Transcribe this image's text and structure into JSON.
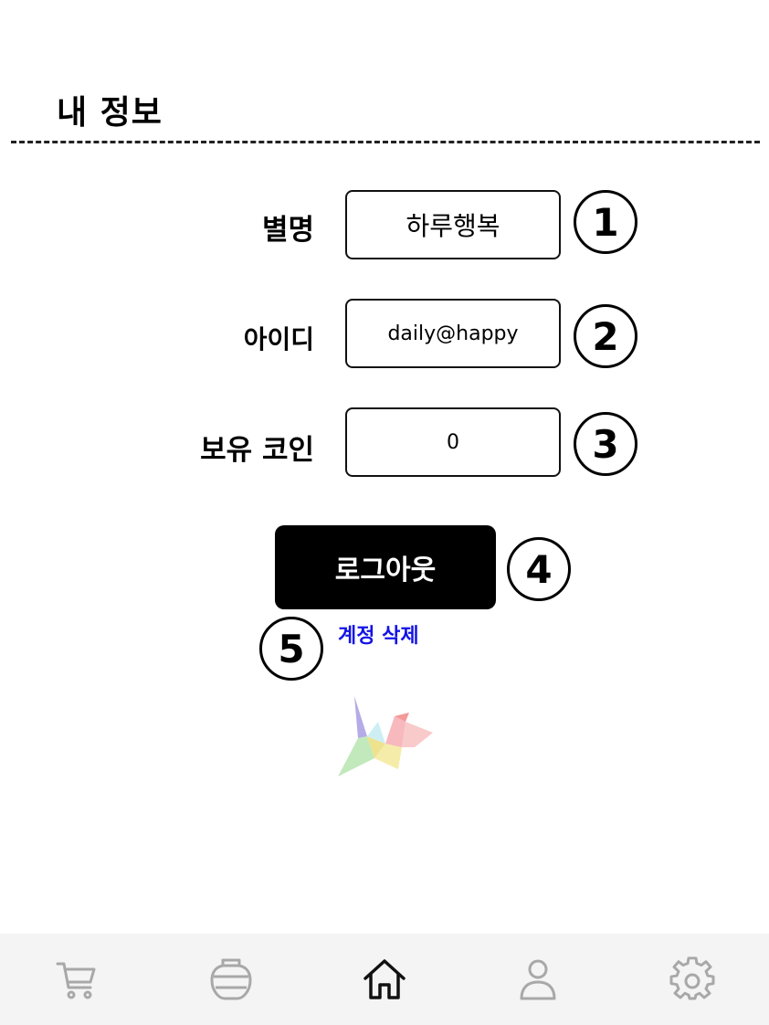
{
  "page": {
    "title": "내 정보"
  },
  "profile": {
    "nickname": {
      "label": "별명",
      "value": "하루행복"
    },
    "user_id": {
      "label": "아이디",
      "value": "daily@happy"
    },
    "coins": {
      "label": "보유 코인",
      "value": "0"
    }
  },
  "actions": {
    "logout_label": "로그아웃",
    "delete_account_label": "계정 삭제"
  },
  "markers": [
    "1",
    "2",
    "3",
    "4",
    "5"
  ],
  "bottom_nav": {
    "items": [
      {
        "icon": "cart-icon",
        "active": false
      },
      {
        "icon": "jar-icon",
        "active": false
      },
      {
        "icon": "home-icon",
        "active": true
      },
      {
        "icon": "user-icon",
        "active": false
      },
      {
        "icon": "gear-icon",
        "active": false
      }
    ],
    "inactive_color": "#a8a8a8",
    "active_color": "#111111"
  },
  "colors": {
    "delete_link": "#1414e6",
    "logout_bg": "#000000"
  }
}
